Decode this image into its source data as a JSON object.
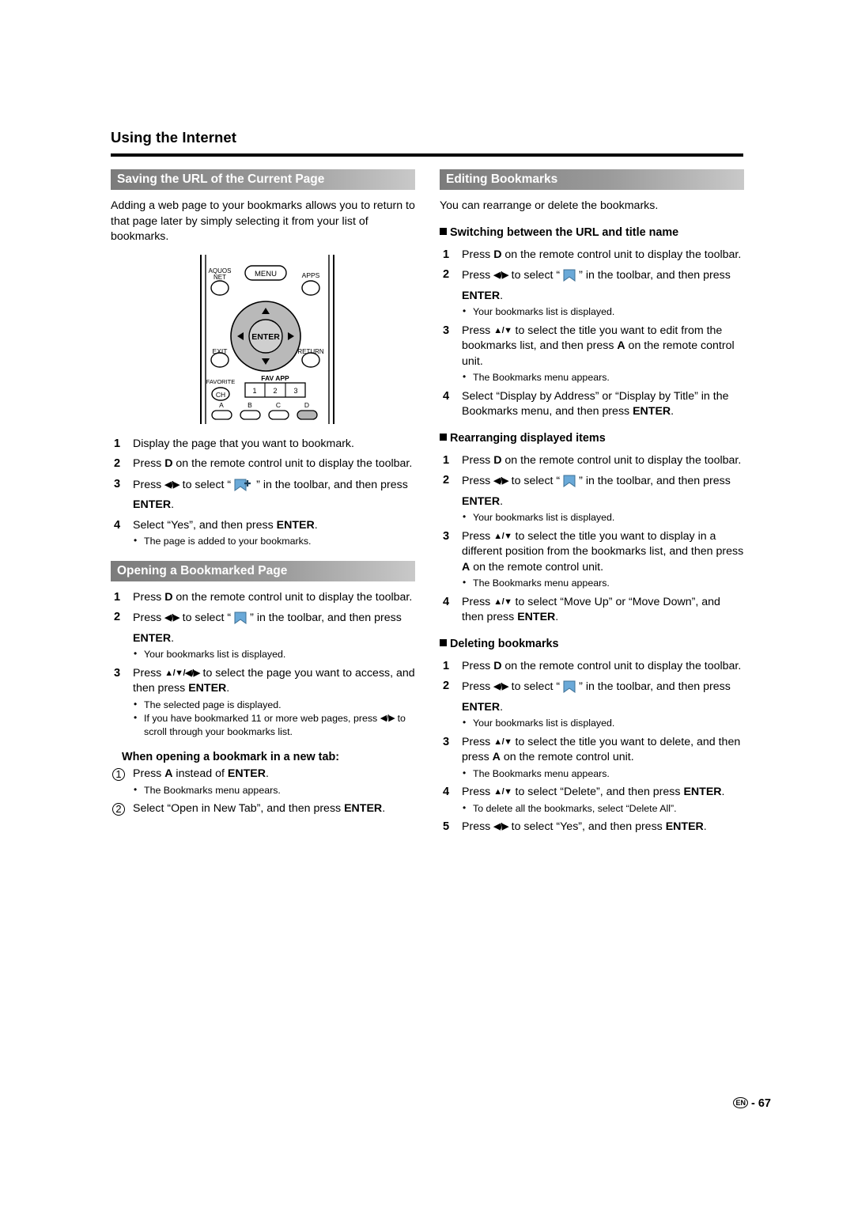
{
  "page": {
    "running_head": "Using the Internet",
    "page_number": "67",
    "page_locale_badge": "EN",
    "page_number_separator": "-"
  },
  "left_column": {
    "section1": {
      "title": "Saving the URL of the Current Page",
      "intro": "Adding a web page to your bookmarks allows you to return to that page later by simply selecting it from your list of bookmarks.",
      "steps": [
        {
          "num": "1",
          "text": "Display the page that you want to bookmark.",
          "bullets": []
        },
        {
          "num": "2",
          "text": "Press D on the remote control unit to display the toolbar.",
          "bullets": []
        },
        {
          "num": "3",
          "text": "Press ◀/▶ to select “[bookmark-add-icon]” in the toolbar, and then press ENTER.",
          "bullets": []
        },
        {
          "num": "4",
          "text": "Select “Yes”, and then press ENTER.",
          "bullets": [
            "The page is added to your bookmarks."
          ]
        }
      ]
    },
    "section2": {
      "title": "Opening a Bookmarked Page",
      "steps": [
        {
          "num": "1",
          "text": "Press D on the remote control unit to display the toolbar.",
          "bullets": []
        },
        {
          "num": "2",
          "text": "Press ◀/▶ to select “[bookmark-icon]” in the toolbar, and then press ENTER.",
          "bullets": [
            "Your bookmarks list is displayed."
          ]
        },
        {
          "num": "3",
          "text": "Press ▲/▼/◀/▶ to select the page you want to access, and then press ENTER.",
          "bullets": [
            "The selected page is displayed.",
            "If you have bookmarked 11 or more web pages, press ◀/▶ to scroll through your bookmarks list."
          ]
        }
      ],
      "subsection": {
        "title": "When opening a bookmark in a new tab:",
        "steps": [
          {
            "num": "1",
            "text": "Press A instead of ENTER.",
            "bullets": [
              "The Bookmarks menu appears."
            ]
          },
          {
            "num": "2",
            "text": "Select “Open in New Tab”, and then press ENTER.",
            "bullets": []
          }
        ]
      }
    },
    "remote_figure": {
      "alt": "remote-control-illustration",
      "buttons": {
        "aquos_net": "AQUOS NET",
        "menu": "MENU",
        "apps": "APPS",
        "enter": "ENTER",
        "exit": "EXIT",
        "return": "RETURN",
        "fav_app": "FAV APP",
        "favorite": "FAVORITE",
        "ch": "CH",
        "fav_numbers": [
          "1",
          "2",
          "3"
        ],
        "color_keys": [
          "A",
          "B",
          "C",
          "D"
        ]
      }
    }
  },
  "right_column": {
    "section": {
      "title": "Editing Bookmarks",
      "intro": "You can rearrange or delete the  bookmarks.",
      "sub1": {
        "title": "Switching between the URL and title name",
        "steps": [
          {
            "num": "1",
            "text": "Press D on the remote control unit to display the toolbar.",
            "bullets": []
          },
          {
            "num": "2",
            "text": "Press ◀/▶ to select “[bookmark-icon]” in the toolbar, and then press ENTER.",
            "bullets": [
              "Your bookmarks list is displayed."
            ]
          },
          {
            "num": "3",
            "text": "Press ▲/▼ to select the title you want to edit from the bookmarks list, and then press A on the remote control unit.",
            "bullets": [
              "The Bookmarks menu appears."
            ]
          },
          {
            "num": "4",
            "text": "Select “Display by Address” or “Display by Title” in the Bookmarks menu, and then press ENTER.",
            "bullets": []
          }
        ]
      },
      "sub2": {
        "title": "Rearranging displayed items",
        "steps": [
          {
            "num": "1",
            "text": "Press D on the remote control unit to display the toolbar.",
            "bullets": []
          },
          {
            "num": "2",
            "text": "Press ◀/▶ to select “[bookmark-icon]” in the toolbar, and then press ENTER.",
            "bullets": [
              "Your bookmarks list is displayed."
            ]
          },
          {
            "num": "3",
            "text": "Press ▲/▼ to select the title you want to display in a different position from the bookmarks list, and then press A on the remote control unit.",
            "bullets": [
              "The Bookmarks menu appears."
            ]
          },
          {
            "num": "4",
            "text": "Press ▲/▼ to select “Move Up” or “Move Down”, and then press ENTER.",
            "bullets": []
          }
        ]
      },
      "sub3": {
        "title": "Deleting bookmarks",
        "steps": [
          {
            "num": "1",
            "text": "Press D on the remote control unit to display the toolbar.",
            "bullets": []
          },
          {
            "num": "2",
            "text": "Press ◀/▶ to select “[bookmark-icon]” in the toolbar, and then press ENTER.",
            "bullets": [
              "Your bookmarks list is displayed."
            ]
          },
          {
            "num": "3",
            "text": "Press ▲/▼ to select the title you want to delete, and then press A on the remote control unit.",
            "bullets": [
              "The Bookmarks menu appears."
            ]
          },
          {
            "num": "4",
            "text": "Press ▲/▼ to select “Delete”, and then press ENTER.",
            "bullets": [
              "To delete all the bookmarks, select “Delete All”."
            ]
          },
          {
            "num": "5",
            "text": "Press ◀/▶ to select “Yes”, and then press ENTER.",
            "bullets": []
          }
        ]
      }
    }
  },
  "colors": {
    "bar_dark": "#7b7b7b",
    "bar_light": "#c9c9c9",
    "icon_blue": "#6aa9d8",
    "remote_gray": "#b9b9b9"
  }
}
